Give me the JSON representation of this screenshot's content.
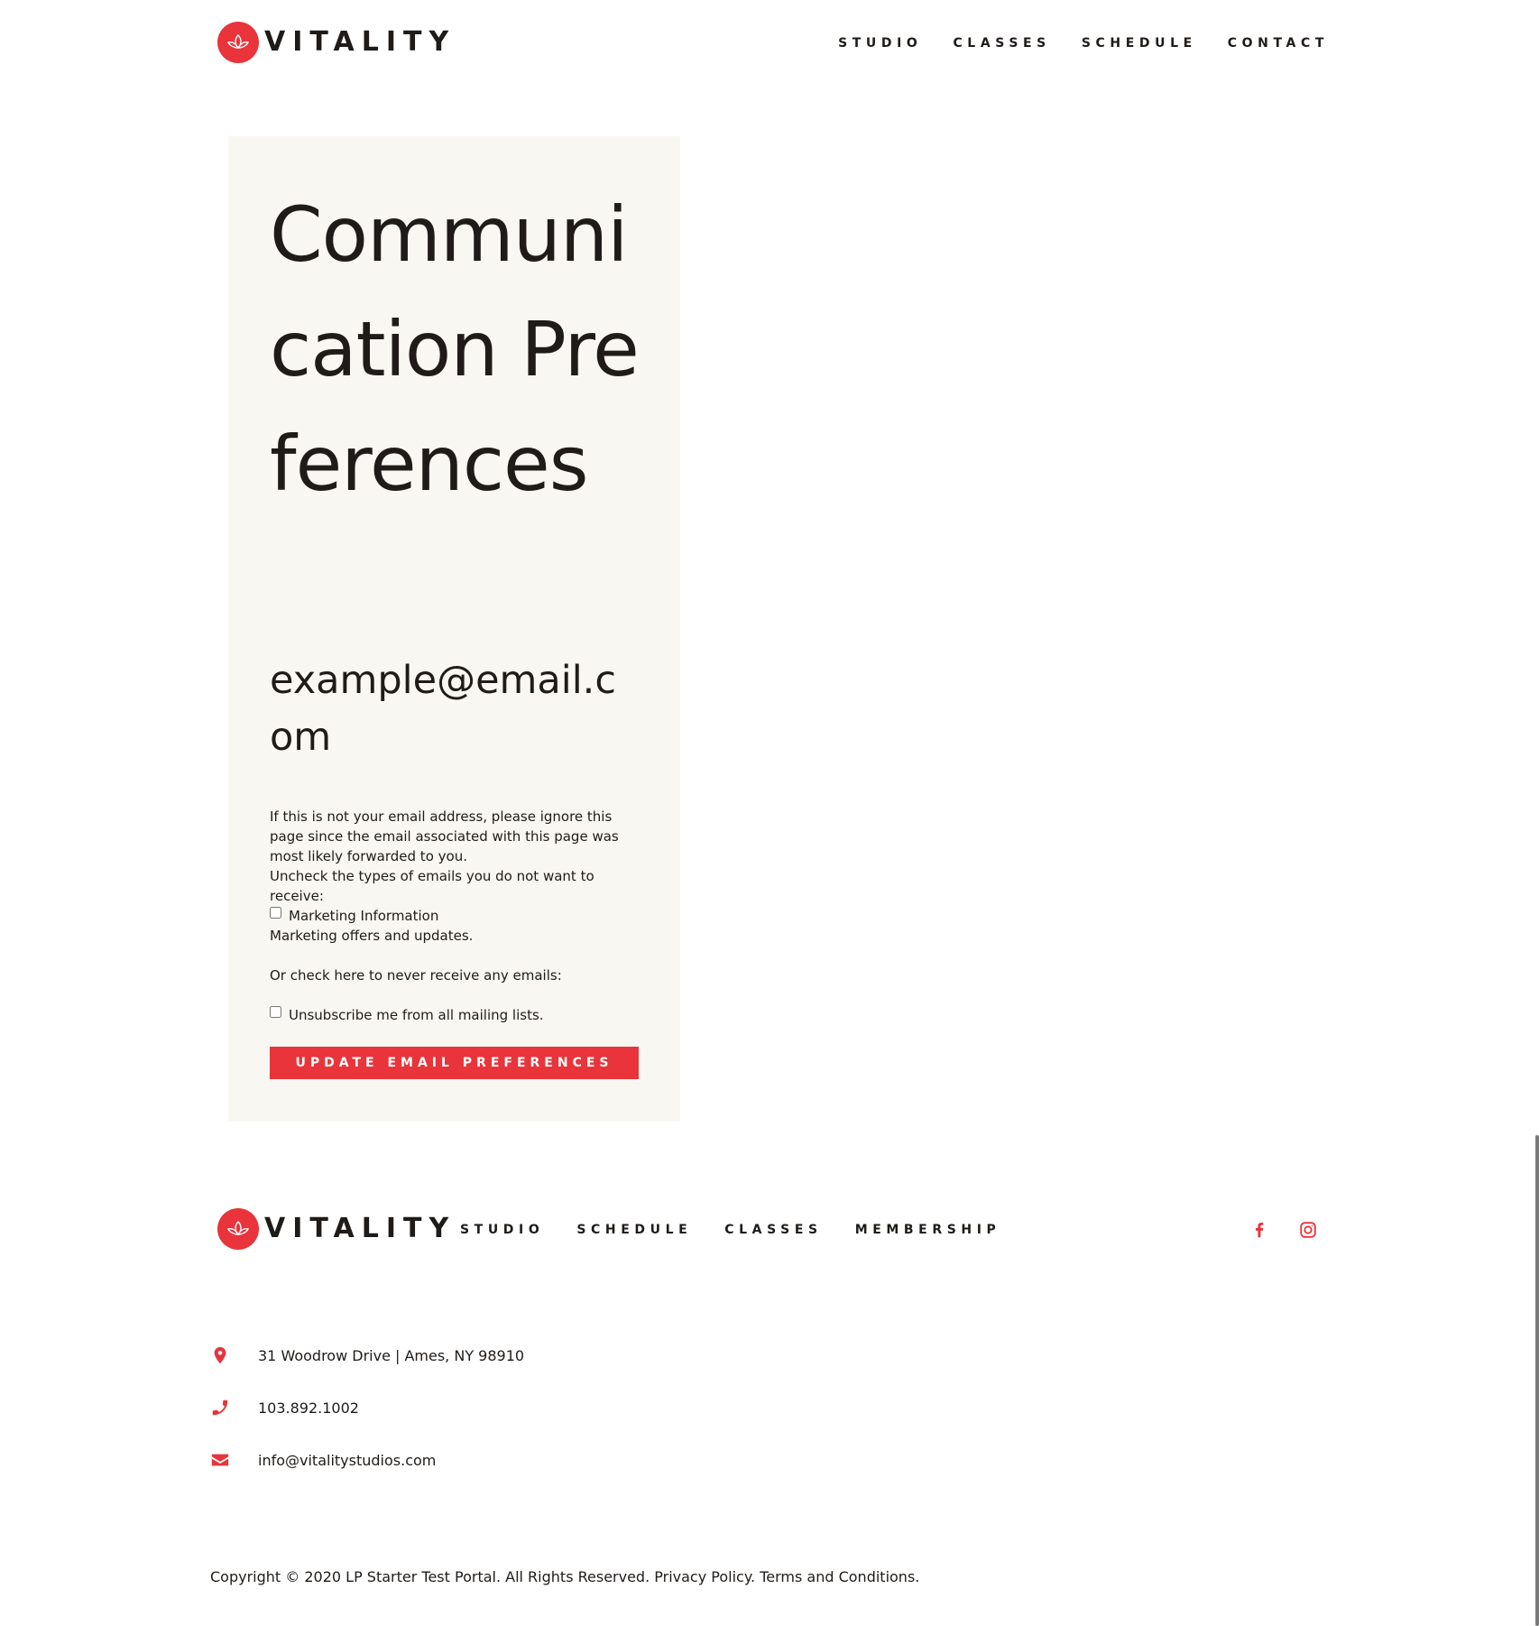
{
  "brand": {
    "name": "VITALITY",
    "accent_color": "#e8343a",
    "logo_icon": "lotus-icon"
  },
  "header": {
    "nav": [
      "STUDIO",
      "CLASSES",
      "SCHEDULE",
      "CONTACT"
    ]
  },
  "card": {
    "title": "Communication Preferences",
    "email": "example@email.com",
    "notice": "If this is not your email address, please ignore this page since the email associated with this page was most likely forwarded to you.",
    "uncheck_prompt": "Uncheck the types of emails you do not want to receive:",
    "marketing_label": "Marketing Information",
    "marketing_desc": "Marketing offers and updates.",
    "never_prompt": "Or check here to never receive any emails:",
    "unsubscribe_label": "Unsubscribe me from all mailing lists.",
    "button_label": "UPDATE EMAIL PREFERENCES"
  },
  "footer": {
    "nav": [
      "STUDIO",
      "SCHEDULE",
      "CLASSES",
      "MEMBERSHIP"
    ],
    "social": [
      "facebook-icon",
      "instagram-icon"
    ],
    "address": "31 Woodrow Drive | Ames, NY 98910",
    "phone": "103.892.1002",
    "email": "info@vitalitystudios.com",
    "copyright_prefix": "Copyright © 2020 LP Starter Test Portal. All Rights Reserved.",
    "privacy_label": "Privacy Policy.",
    "terms_label": "Terms and Conditions."
  }
}
